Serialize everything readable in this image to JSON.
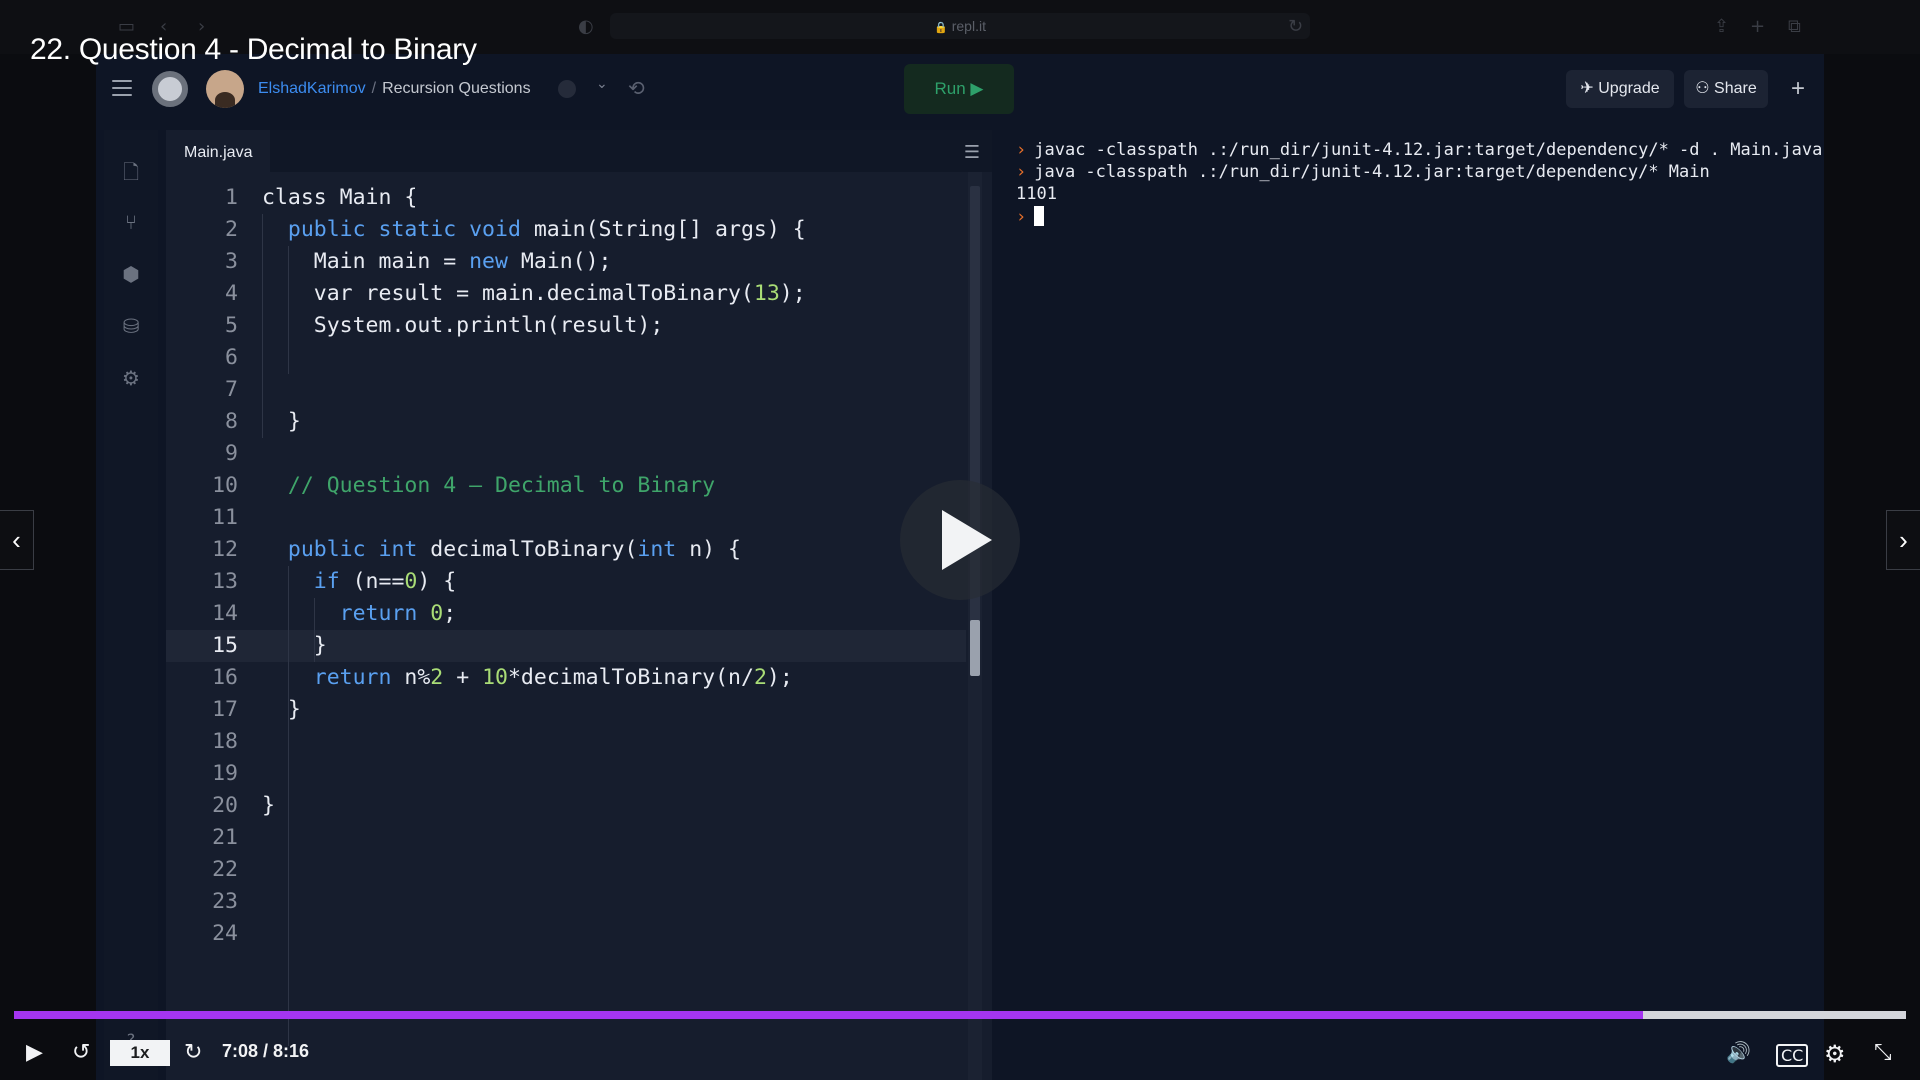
{
  "browser": {
    "url": "repl.it"
  },
  "video": {
    "title": "22. Question 4 - Decimal to Binary",
    "time": "7:08 / 8:16",
    "speed": "1x",
    "progress": 0.861
  },
  "topbar": {
    "user": "ElshadKarimov",
    "separator": "/",
    "repl_name": "Recursion Questions",
    "run_label": "Run ▶",
    "upgrade_label": "Upgrade",
    "share_label": "Share",
    "plus_label": "+"
  },
  "editor": {
    "tab": "Main.java",
    "active_line": 15,
    "lines": [
      {
        "n": "1",
        "html": "class Main {"
      },
      {
        "n": "2",
        "html": "  <span class='kw'>public static void</span> main(String[] args) {"
      },
      {
        "n": "3",
        "html": "    Main main = <span class='kw'>new</span> Main();"
      },
      {
        "n": "4",
        "html": "    var result = main.decimalToBinary(<span class='num'>13</span>);"
      },
      {
        "n": "5",
        "html": "    System.out.println(result);"
      },
      {
        "n": "6",
        "html": ""
      },
      {
        "n": "7",
        "html": ""
      },
      {
        "n": "8",
        "html": "  }"
      },
      {
        "n": "9",
        "html": ""
      },
      {
        "n": "10",
        "html": "  <span class='cm'>// Question 4 — Decimal to Binary</span>"
      },
      {
        "n": "11",
        "html": ""
      },
      {
        "n": "12",
        "html": "  <span class='kw'>public int</span> decimalToBinary(<span class='kw'>int</span> n) {"
      },
      {
        "n": "13",
        "html": "    <span class='kw'>if</span> (n==<span class='num'>0</span>) {"
      },
      {
        "n": "14",
        "html": "      <span class='kw'>return</span> <span class='num'>0</span>;"
      },
      {
        "n": "15",
        "html": "    }"
      },
      {
        "n": "16",
        "html": "    <span class='kw'>return</span> n%<span class='num'>2</span> + <span class='num'>10</span>*decimalToBinary(n/<span class='num'>2</span>);"
      },
      {
        "n": "17",
        "html": "  }"
      },
      {
        "n": "18",
        "html": ""
      },
      {
        "n": "19",
        "html": ""
      },
      {
        "n": "20",
        "html": "}"
      },
      {
        "n": "21",
        "html": ""
      },
      {
        "n": "22",
        "html": ""
      },
      {
        "n": "23",
        "html": ""
      },
      {
        "n": "24",
        "html": ""
      }
    ]
  },
  "console": {
    "lines": [
      {
        "prompt": true,
        "text": "javac -classpath .:/run_dir/junit-4.12.jar:target/dependency/* -d . Main.java"
      },
      {
        "prompt": true,
        "text": "java -classpath .:/run_dir/junit-4.12.jar:target/dependency/* Main"
      },
      {
        "prompt": false,
        "text": "1101"
      }
    ]
  },
  "colors": {
    "accent": "#a435f0",
    "keyword": "#5aa0f0",
    "comment": "#3fa56a",
    "number": "#a9dc76",
    "prompt": "#e8702a",
    "link": "#3c8cf0"
  }
}
